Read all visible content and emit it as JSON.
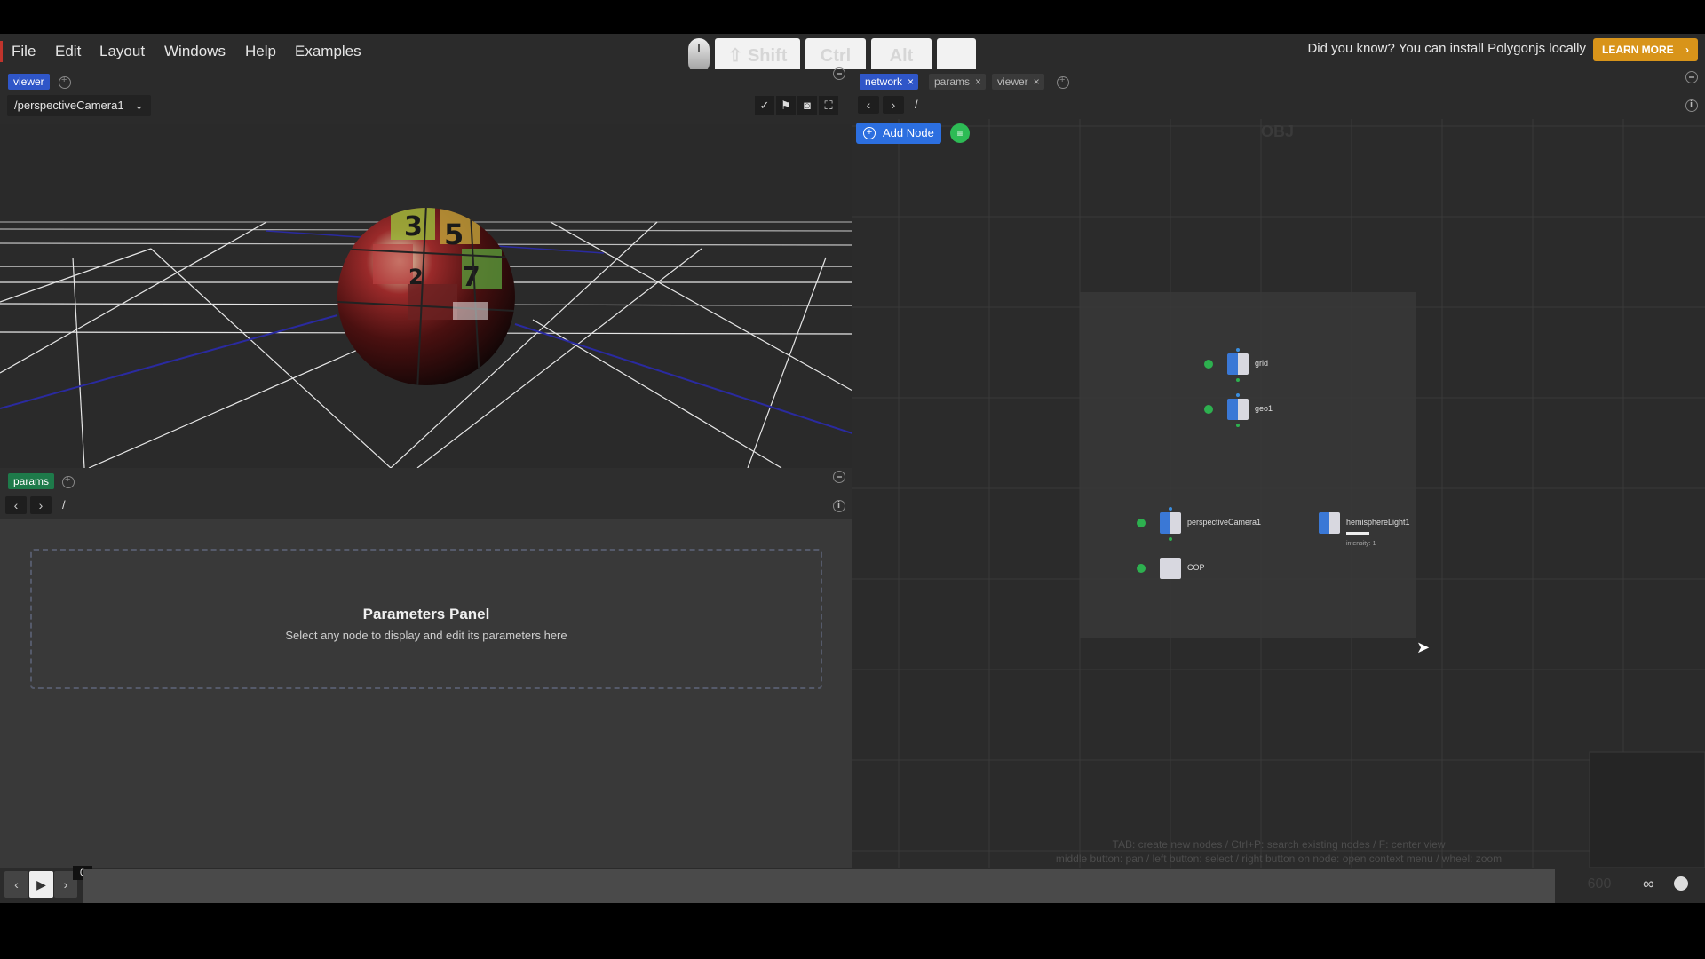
{
  "menu": {
    "items": [
      "File",
      "Edit",
      "Layout",
      "Windows",
      "Help",
      "Examples"
    ],
    "keys": [
      "Shift",
      "Ctrl",
      "Alt",
      ""
    ],
    "tip": "Did you know? You can install Polygonjs locally",
    "learn_more": "LEARN MORE"
  },
  "viewer": {
    "tab": "viewer",
    "camera": "/perspectiveCamera1"
  },
  "params": {
    "tab": "params",
    "path": "/",
    "title": "Parameters Panel",
    "subtitle": "Select any node to display and edit its parameters here"
  },
  "network": {
    "tabs": [
      {
        "label": "network",
        "active": true
      },
      {
        "label": "params",
        "active": false
      },
      {
        "label": "viewer",
        "active": false
      }
    ],
    "path": "/",
    "add_node": "Add Node",
    "context": "OBJ",
    "nodes": [
      {
        "name": "grid"
      },
      {
        "name": "geo1"
      },
      {
        "name": "perspectiveCamera1"
      },
      {
        "name": "COP"
      },
      {
        "name": "hemisphereLight1",
        "sub": "intensity: 1"
      }
    ],
    "hint1": "TAB: create new nodes / Ctrl+P: search existing nodes / F: center view",
    "hint2": "middle button: pan / left button: select / right button on node: open context menu / wheel: zoom"
  },
  "timeline": {
    "frame": "0",
    "end_frame": "600"
  },
  "colors": {
    "viewer_tag": "#2f56c8",
    "params_tag": "#1e7a4a",
    "network_tag": "#2f56c8",
    "learn_btn": "#d8941a",
    "add_node": "#2c6fe0"
  }
}
